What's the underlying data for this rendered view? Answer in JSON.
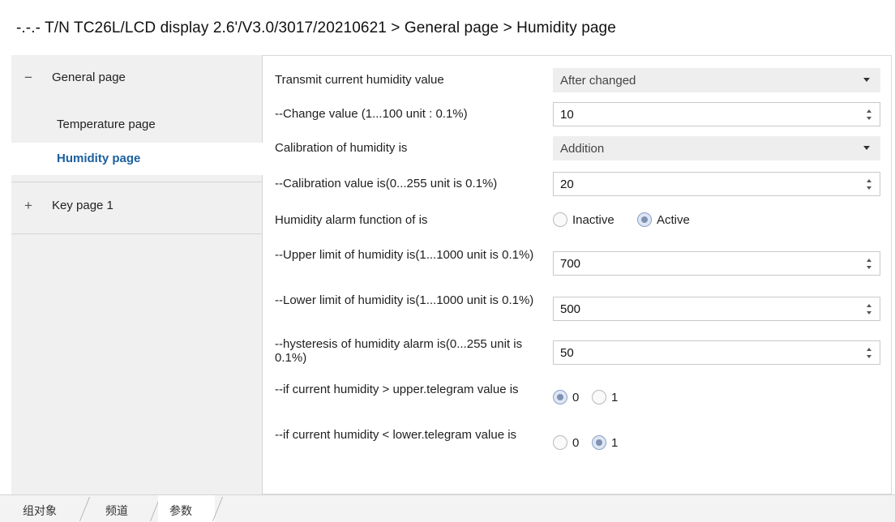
{
  "header": {
    "title": "-.-.- T/N TC26L/LCD display 2.6'/V3.0/3017/20210621 > General page > Humidity page"
  },
  "sidebar": {
    "groups": [
      {
        "sign": "−",
        "label": "General page",
        "expanded": true,
        "items": [
          {
            "label": "Temperature page",
            "selected": false
          },
          {
            "label": "Humidity page",
            "selected": true
          }
        ]
      },
      {
        "sign": "+",
        "label": "Key page 1",
        "expanded": false,
        "items": []
      }
    ]
  },
  "params": {
    "p1": {
      "label": "Transmit current humidity value",
      "type": "dropdown",
      "value": "After changed"
    },
    "p2": {
      "label": "--Change value (1...100 unit : 0.1%)",
      "type": "spin",
      "value": "10"
    },
    "p3": {
      "label": "Calibration of humidity is",
      "type": "dropdown",
      "value": "Addition"
    },
    "p4": {
      "label": "--Calibration value is(0...255 unit is 0.1%)",
      "type": "spin",
      "value": "20"
    },
    "p5": {
      "label": "Humidity alarm function of is",
      "type": "radio",
      "options": [
        "Inactive",
        "Active"
      ],
      "selected": "Active"
    },
    "p6": {
      "label": "--Upper limit of humidity is(1...1000 unit is 0.1%)",
      "type": "spin",
      "value": "700"
    },
    "p7": {
      "label": "--Lower limit of humidity is(1...1000 unit is 0.1%)",
      "type": "spin",
      "value": "500"
    },
    "p8": {
      "label": "--hysteresis of humidity alarm is(0...255 unit is 0.1%)",
      "type": "spin",
      "value": "50"
    },
    "p9": {
      "label": "--if current humidity > upper.telegram value is",
      "type": "radio",
      "options": [
        "0",
        "1"
      ],
      "selected": "0"
    },
    "p10": {
      "label": "--if current humidity < lower.telegram value is",
      "type": "radio",
      "options": [
        "0",
        "1"
      ],
      "selected": "1"
    }
  },
  "bottom_tabs": [
    {
      "label": "组对象",
      "active": false
    },
    {
      "label": "频道",
      "active": false
    },
    {
      "label": "参数",
      "active": true
    }
  ],
  "icons": {
    "expanded": "minus-icon",
    "collapsed": "plus-icon",
    "dropdown": "chevron-down-icon",
    "spinner": "spinner-arrows-icon"
  }
}
